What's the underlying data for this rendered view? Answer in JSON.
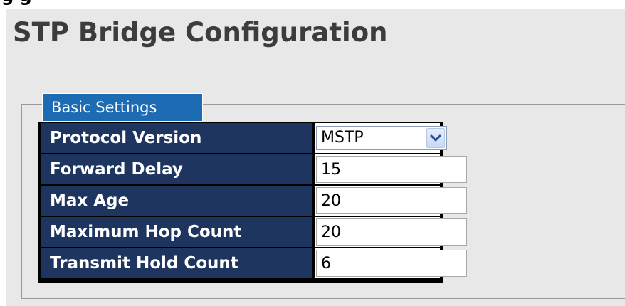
{
  "top_heading_fragment": "g   g",
  "page": {
    "title": "STP Bridge Configuration"
  },
  "basic_settings": {
    "legend": "Basic Settings",
    "rows": [
      {
        "label": "Protocol Version",
        "value": "MSTP"
      },
      {
        "label": "Forward Delay",
        "value": "15"
      },
      {
        "label": "Max Age",
        "value": "20"
      },
      {
        "label": "Maximum Hop Count",
        "value": "20"
      },
      {
        "label": "Transmit Hold Count",
        "value": "6"
      }
    ]
  },
  "icons": {
    "select_arrow": "chevron-down-icon"
  },
  "colors": {
    "panel_background": "#e8e8e8",
    "legend_background": "#1d6bb3",
    "label_background": "#1e3560"
  }
}
